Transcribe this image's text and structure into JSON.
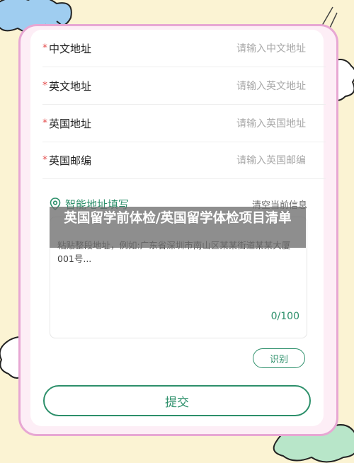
{
  "form": {
    "fields": [
      {
        "required_mark": "*",
        "label": "中文地址",
        "placeholder": "请输入中文地址"
      },
      {
        "required_mark": "*",
        "label": "英文地址",
        "placeholder": "请输入英文地址"
      },
      {
        "required_mark": "*",
        "label": "英国地址",
        "placeholder": "请输入英国地址"
      },
      {
        "required_mark": "*",
        "label": "英国邮编",
        "placeholder": "请输入英国邮编"
      }
    ]
  },
  "smart_fill": {
    "title": "智能地址填写",
    "clear_label": "清空当前信息",
    "placeholder": "粘贴整段地址，例如:广东省深圳市南山区某某街道某某大厦001号...",
    "counter": "0/100",
    "recognize_label": "识别"
  },
  "overlay_title": "英国留学前体检/英国留学体检项目清单",
  "submit_label": "提交",
  "colors": {
    "accent": "#2c8f6a",
    "frame_border": "#e7a7d3",
    "background": "#fbf3d3",
    "required": "#e34b4b"
  },
  "icons": {
    "smart_fill": "location-pin-icon"
  }
}
